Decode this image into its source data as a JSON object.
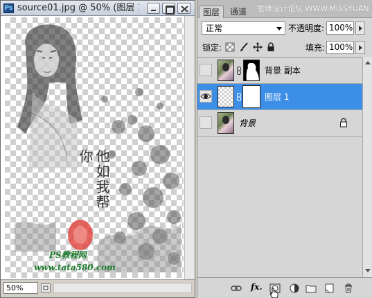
{
  "document": {
    "title": "source01.jpg @ 50% (图层 1",
    "app_badge": "Ps",
    "zoom": "50%",
    "canvas_text": {
      "calligraphy": "他如我帮你",
      "watermark_line1": "PS教程网",
      "watermark_line2": "www.tata580.com"
    }
  },
  "panel": {
    "tabs": [
      {
        "label": "图层",
        "active": true
      },
      {
        "label": "通道",
        "active": false
      }
    ],
    "watermark": "思缘设计论坛 WWW.MISSYUAN.COM",
    "blend_mode": "正常",
    "opacity_label": "不透明度:",
    "opacity_value": "100%",
    "lock_label": "锁定:",
    "fill_label": "填充:",
    "fill_value": "100%",
    "layers": [
      {
        "name": "背景 副本",
        "visible": false,
        "selected": false
      },
      {
        "name": "图层 1",
        "visible": true,
        "selected": true
      },
      {
        "name": "背景",
        "visible": false,
        "selected": false,
        "locked": true
      }
    ],
    "footer": {
      "fx_label": "fx."
    }
  },
  "colors": {
    "selection": "#3d8ee6",
    "panel_bg": "#d6d6d6",
    "seal_red": "#e0413a"
  }
}
